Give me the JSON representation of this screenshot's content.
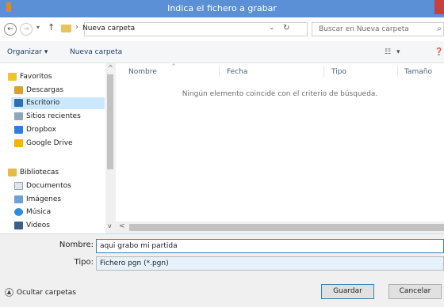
{
  "window": {
    "title": "Indica el fichero a grabar"
  },
  "address": {
    "back_glyph": "←",
    "forward_glyph": "→",
    "dropdown_glyph": "▾",
    "up_glyph": "↑",
    "sep_glyph": "›",
    "path": "Nueva carpeta",
    "path_dropdown_glyph": "⌄",
    "refresh_glyph": "↻",
    "search_placeholder": "Buscar en Nueva carpeta",
    "search_glyph": "⌕"
  },
  "toolbar": {
    "organize": "Organizar",
    "organize_glyph": "▾",
    "new_folder": "Nueva carpeta",
    "view_glyph": "☷",
    "view_dropdown_glyph": "▾",
    "help_glyph": "❓"
  },
  "nav": {
    "items": [
      {
        "label": "Favoritos",
        "icon": "star-icon"
      },
      {
        "label": "Descargas",
        "icon": "downloads-icon"
      },
      {
        "label": "Escritorio",
        "icon": "desktop-icon"
      },
      {
        "label": "Sitios recientes",
        "icon": "recent-places-icon"
      },
      {
        "label": "Dropbox",
        "icon": "dropbox-icon"
      },
      {
        "label": "Google Drive",
        "icon": "google-drive-icon"
      },
      {
        "label": "Bibliotecas",
        "icon": "libraries-icon"
      },
      {
        "label": "Documentos",
        "icon": "documents-icon"
      },
      {
        "label": "Imágenes",
        "icon": "images-icon"
      },
      {
        "label": "Música",
        "icon": "music-icon"
      },
      {
        "label": "Videos",
        "icon": "videos-icon"
      }
    ],
    "scroll_up_glyph": "^",
    "scroll_down_glyph": "v"
  },
  "content": {
    "columns": [
      "Nombre",
      "Fecha",
      "Tipo",
      "Tamaño"
    ],
    "sort_glyph": "^",
    "empty_message": "Ningún elemento coincide con el criterio de búsqueda.",
    "hscroll_left_glyph": "<"
  },
  "form": {
    "name_label": "Nombre:",
    "name_value": "aqui grabo mi partida",
    "type_label": "Tipo:",
    "type_value": "Fichero pgn (*.pgn)"
  },
  "buttons": {
    "hide_folders": "Ocultar carpetas",
    "hide_folders_glyph": "▲",
    "save": "Guardar",
    "cancel": "Cancelar"
  },
  "colors": {
    "title_bar": "#5b8fd6",
    "selection": "#cce8ff",
    "accent": "#3c7fb1"
  }
}
